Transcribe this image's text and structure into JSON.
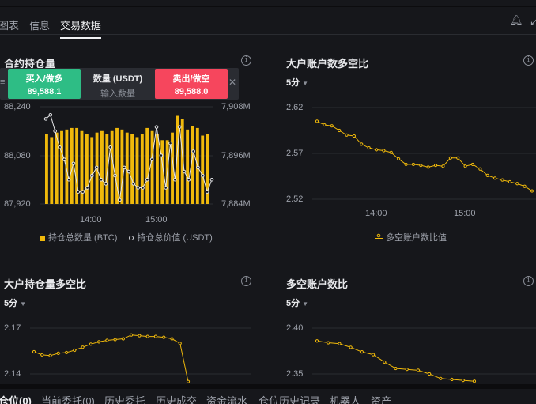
{
  "tabs": [
    {
      "label": "图表"
    },
    {
      "label": "信息"
    },
    {
      "label": "交易数据",
      "active": true
    }
  ],
  "trade_bar": {
    "buy_label": "买入/做多",
    "buy_price": "89,588.1",
    "qty_label": "数量 (USDT)",
    "qty_placeholder": "输入数量",
    "sell_label": "卖出/做空",
    "sell_price": "89,588.0"
  },
  "panels": {
    "open_interest": {
      "title": "合约持仓量",
      "interval": "",
      "legend_bar": "持仓总数量 (BTC)",
      "legend_line": "持仓总价值 (USDT)"
    },
    "top_accounts": {
      "title": "大户账户数多空比",
      "interval": "5分",
      "legend": "多空账户数比值"
    },
    "top_positions": {
      "title": "大户持仓量多空比",
      "interval": "5分"
    },
    "account_ratio": {
      "title": "多空账户数比",
      "interval": "5分"
    }
  },
  "bottom_tabs": [
    {
      "label": "仓位(0)",
      "active": true
    },
    {
      "label": "当前委托(0)"
    },
    {
      "label": "历史委托"
    },
    {
      "label": "历史成交"
    },
    {
      "label": "资金流水"
    },
    {
      "label": "仓位历史记录"
    },
    {
      "label": "机器人"
    },
    {
      "label": "资产"
    }
  ],
  "colors": {
    "accent": "#f0b90b",
    "buy": "#2ebd85",
    "sell": "#f6465d",
    "bg": "#16171b",
    "grid": "#2a2c31"
  },
  "chart_data": [
    {
      "type": "bar",
      "title": "合约持仓量",
      "x_ticks": [
        "14:00",
        "15:00"
      ],
      "y_left_ticks": [
        "88,240",
        "88,080",
        "87,920"
      ],
      "y_left_range": [
        87920,
        88240
      ],
      "y_right_ticks": [
        "7,908M",
        "7,896M",
        "7,884M"
      ],
      "y_right_range": [
        7884,
        7908
      ],
      "series": [
        {
          "name": "持仓总数量 (BTC)",
          "axis": "left",
          "values": [
            88150,
            88140,
            88155,
            88160,
            88165,
            88170,
            88170,
            88160,
            88150,
            88140,
            88155,
            88160,
            88150,
            88160,
            88170,
            88165,
            88155,
            88150,
            88140,
            88150,
            88170,
            88160,
            88150,
            88130,
            88130,
            88155,
            88210,
            88200,
            88165,
            88175,
            88170,
            88145,
            88150
          ]
        },
        {
          "name": "持仓总价值 (USDT)",
          "axis": "right",
          "values": [
            7905,
            7906,
            7902,
            7898,
            7895,
            7890,
            7894,
            7887,
            7887,
            7888,
            7891,
            7893,
            7890,
            7889,
            7898,
            7891,
            7885,
            7893,
            7892,
            7889,
            7888,
            7888,
            7890,
            7895,
            7903,
            7896,
            7888,
            7899,
            7890,
            7903,
            7892,
            7890,
            7897,
            7893,
            7891,
            7887,
            7890
          ]
        }
      ]
    },
    {
      "type": "line",
      "title": "大户账户数多空比",
      "x_ticks": [
        "14:00",
        "15:00"
      ],
      "y_ticks": [
        "2.62",
        "2.57",
        "2.52"
      ],
      "ylim": [
        2.52,
        2.62
      ],
      "series": [
        {
          "name": "多空账户数比值",
          "values": [
            2.605,
            2.601,
            2.6,
            2.595,
            2.59,
            2.589,
            2.58,
            2.576,
            2.574,
            2.573,
            2.571,
            2.564,
            2.558,
            2.558,
            2.557,
            2.555,
            2.557,
            2.556,
            2.565,
            2.565,
            2.556,
            2.558,
            2.553,
            2.546,
            2.543,
            2.541,
            2.539,
            2.537,
            2.534,
            2.529
          ]
        }
      ]
    },
    {
      "type": "line",
      "title": "大户持仓量多空比",
      "y_ticks": [
        "2.17",
        "2.14"
      ],
      "ylim": [
        2.14,
        2.17
      ],
      "series": [
        {
          "values": [
            2.1545,
            2.1525,
            2.152,
            2.1535,
            2.154,
            2.1555,
            2.1575,
            2.1595,
            2.161,
            2.162,
            2.1625,
            2.163,
            2.1655,
            2.165,
            2.1645,
            2.1645,
            2.164,
            2.163,
            2.16,
            2.135
          ]
        }
      ]
    },
    {
      "type": "line",
      "title": "多空账户数比",
      "y_ticks": [
        "2.40",
        "2.35"
      ],
      "ylim": [
        2.35,
        2.4
      ],
      "series": [
        {
          "values": [
            2.386,
            2.384,
            2.383,
            2.379,
            2.374,
            2.371,
            2.363,
            2.356,
            2.355,
            2.354,
            2.35,
            2.345,
            2.344,
            2.343,
            2.342
          ]
        }
      ]
    }
  ]
}
